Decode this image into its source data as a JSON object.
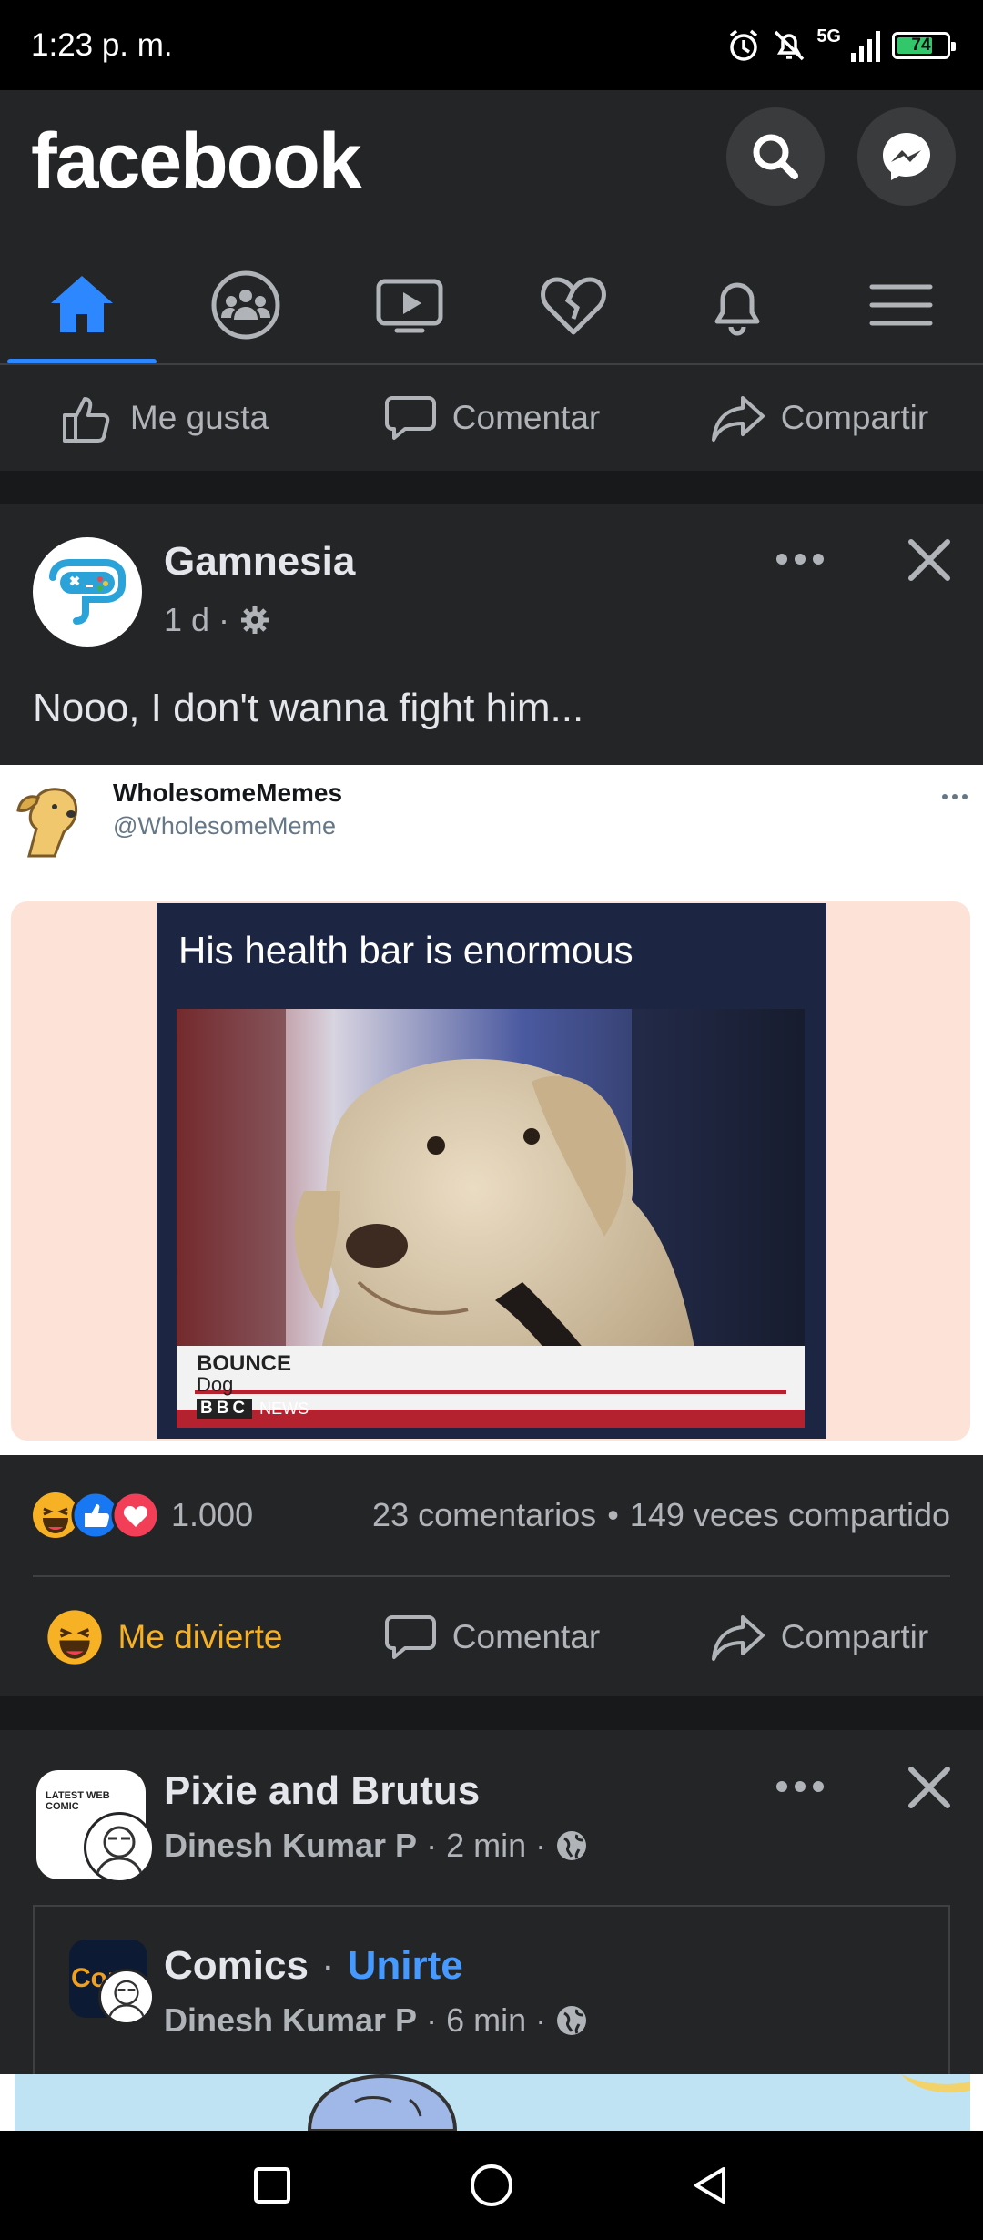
{
  "status_bar": {
    "time": "1:23 p. m.",
    "network": "5G",
    "battery": "74",
    "battery_level": 0.74
  },
  "header": {
    "logo": "facebook"
  },
  "top_actions": {
    "like": "Me gusta",
    "comment": "Comentar",
    "share": "Compartir"
  },
  "post1": {
    "page_name": "Gamnesia",
    "time": "1 d",
    "caption": "Nooo, I don't wanna fight him...",
    "tweet": {
      "display_name": "WholesomeMemes",
      "handle": "@WholesomeMeme",
      "meme_text": "His health bar is enormous",
      "lower_third_title": "BOUNCE",
      "lower_third_sub": "Dog",
      "broadcaster": "BBC",
      "broadcaster_suffix": "NEWS"
    },
    "reaction_count": "1.000",
    "comments": "23 comentarios",
    "shares": "149 veces compartido",
    "actions": {
      "reaction": "Me divierte",
      "comment": "Comentar",
      "share": "Compartir"
    }
  },
  "post2": {
    "title": "Pixie and Brutus",
    "author": "Dinesh Kumar P",
    "time": "2 min",
    "avatar_text": "LATEST WEB COMIC",
    "shared": {
      "group": "Comics",
      "join": "Unirte",
      "author": "Dinesh Kumar P",
      "time": "6 min",
      "avatar_text": "Com"
    }
  },
  "colors": {
    "accent": "#2d88ff",
    "haha": "#f7b125",
    "like": "#1877f2",
    "love": "#f33e58"
  }
}
